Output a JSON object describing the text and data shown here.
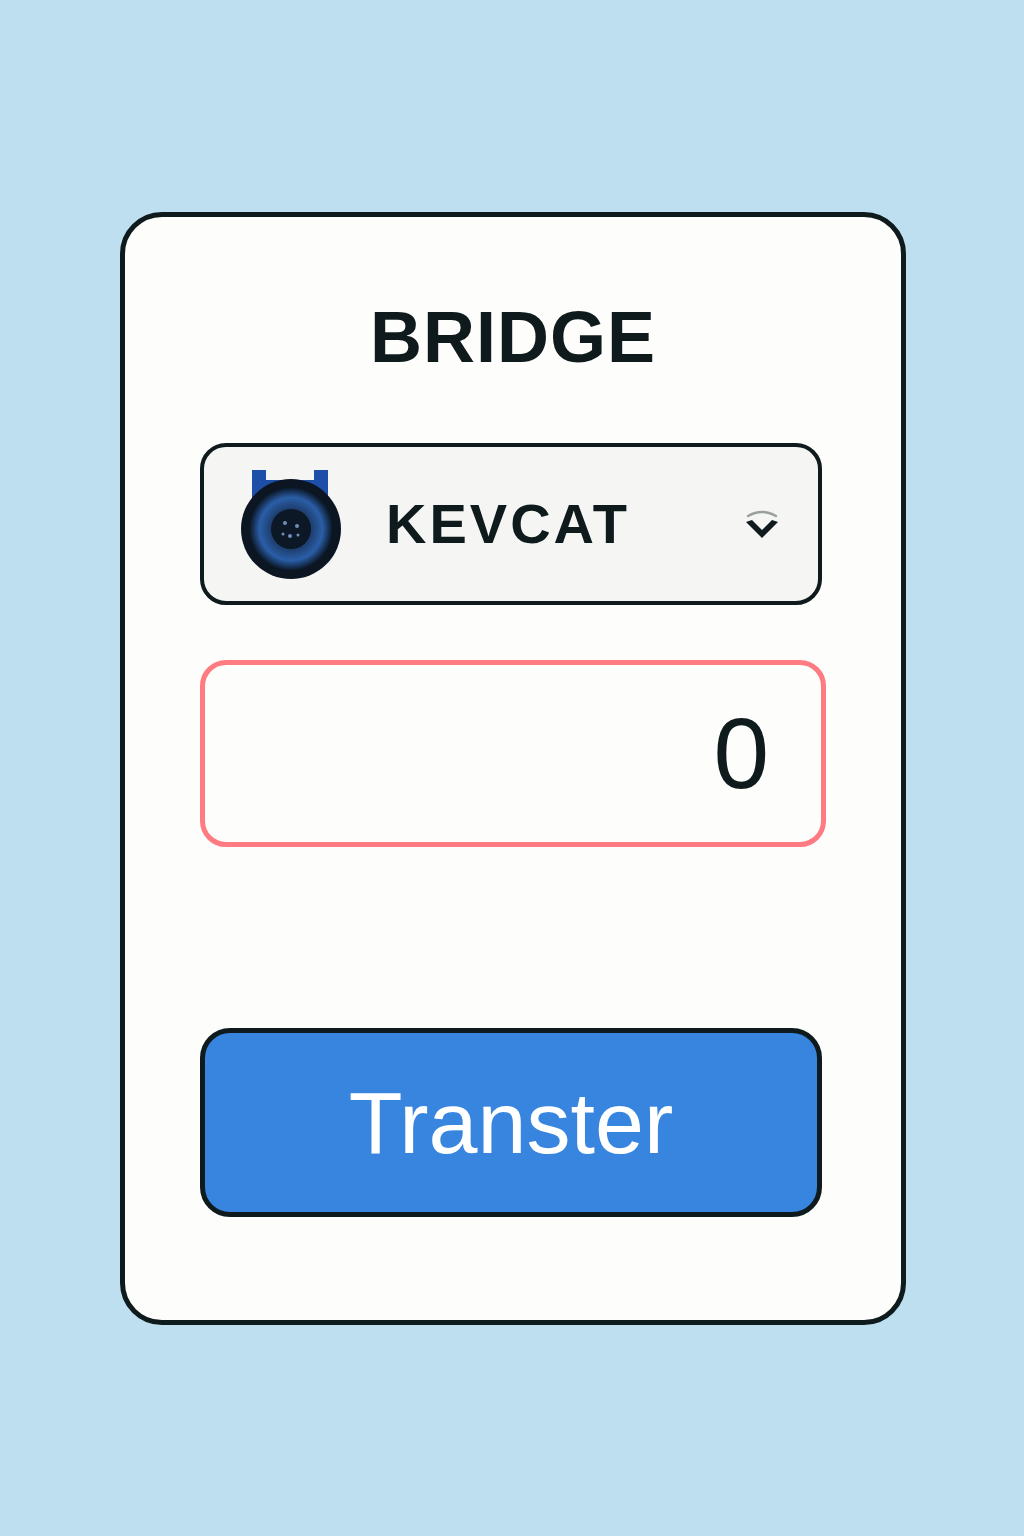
{
  "title": "BRIDGE",
  "token_select": {
    "token": "KEVCAT"
  },
  "amount_field": {
    "value": "0",
    "error": true
  },
  "transfer_button": {
    "label": "Transter"
  }
}
